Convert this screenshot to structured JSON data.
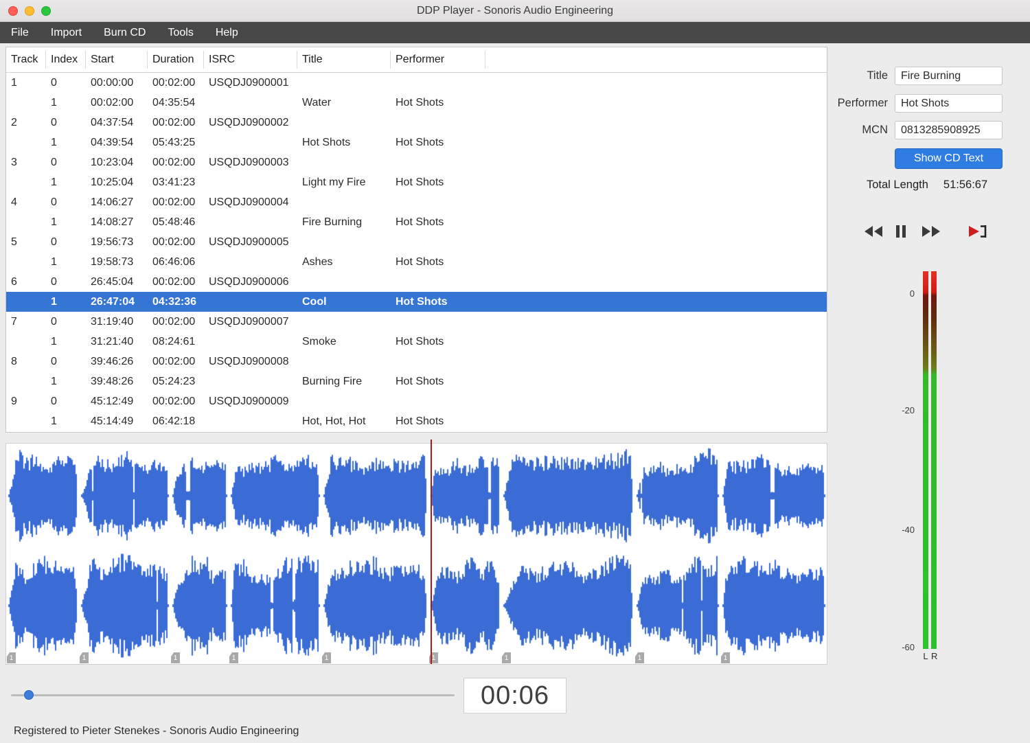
{
  "colors": {
    "selection": "#3575d3",
    "accent_button": "#2f7de2",
    "waveform": "#3b6cd6",
    "playhead": "#b01818"
  },
  "titlebar": {
    "title": "DDP Player - Sonoris Audio Engineering"
  },
  "menu": {
    "items": [
      "File",
      "Import",
      "Burn CD",
      "Tools",
      "Help"
    ]
  },
  "table": {
    "columns": [
      "Track",
      "Index",
      "Start",
      "Duration",
      "ISRC",
      "Title",
      "Performer"
    ],
    "rows": [
      {
        "track": "1",
        "index": "0",
        "start": "00:00:00",
        "duration": "00:02:00",
        "isrc": "USQDJ0900001",
        "title": "",
        "performer": ""
      },
      {
        "track": "",
        "index": "1",
        "start": "00:02:00",
        "duration": "04:35:54",
        "isrc": "",
        "title": "Water",
        "performer": "Hot Shots"
      },
      {
        "track": "2",
        "index": "0",
        "start": "04:37:54",
        "duration": "00:02:00",
        "isrc": "USQDJ0900002",
        "title": "",
        "performer": ""
      },
      {
        "track": "",
        "index": "1",
        "start": "04:39:54",
        "duration": "05:43:25",
        "isrc": "",
        "title": "Hot Shots",
        "performer": "Hot Shots"
      },
      {
        "track": "3",
        "index": "0",
        "start": "10:23:04",
        "duration": "00:02:00",
        "isrc": "USQDJ0900003",
        "title": "",
        "performer": ""
      },
      {
        "track": "",
        "index": "1",
        "start": "10:25:04",
        "duration": "03:41:23",
        "isrc": "",
        "title": "Light my Fire",
        "performer": "Hot Shots"
      },
      {
        "track": "4",
        "index": "0",
        "start": "14:06:27",
        "duration": "00:02:00",
        "isrc": "USQDJ0900004",
        "title": "",
        "performer": ""
      },
      {
        "track": "",
        "index": "1",
        "start": "14:08:27",
        "duration": "05:48:46",
        "isrc": "",
        "title": "Fire Burning",
        "performer": "Hot Shots"
      },
      {
        "track": "5",
        "index": "0",
        "start": "19:56:73",
        "duration": "00:02:00",
        "isrc": "USQDJ0900005",
        "title": "",
        "performer": ""
      },
      {
        "track": "",
        "index": "1",
        "start": "19:58:73",
        "duration": "06:46:06",
        "isrc": "",
        "title": "Ashes",
        "performer": "Hot Shots"
      },
      {
        "track": "6",
        "index": "0",
        "start": "26:45:04",
        "duration": "00:02:00",
        "isrc": "USQDJ0900006",
        "title": "",
        "performer": ""
      },
      {
        "track": "",
        "index": "1",
        "start": "26:47:04",
        "duration": "04:32:36",
        "isrc": "",
        "title": "Cool",
        "performer": "Hot Shots",
        "selected": true
      },
      {
        "track": "7",
        "index": "0",
        "start": "31:19:40",
        "duration": "00:02:00",
        "isrc": "USQDJ0900007",
        "title": "",
        "performer": ""
      },
      {
        "track": "",
        "index": "1",
        "start": "31:21:40",
        "duration": "08:24:61",
        "isrc": "",
        "title": "Smoke",
        "performer": "Hot Shots"
      },
      {
        "track": "8",
        "index": "0",
        "start": "39:46:26",
        "duration": "00:02:00",
        "isrc": "USQDJ0900008",
        "title": "",
        "performer": ""
      },
      {
        "track": "",
        "index": "1",
        "start": "39:48:26",
        "duration": "05:24:23",
        "isrc": "",
        "title": "Burning Fire",
        "performer": "Hot Shots"
      },
      {
        "track": "9",
        "index": "0",
        "start": "45:12:49",
        "duration": "00:02:00",
        "isrc": "USQDJ0900009",
        "title": "",
        "performer": ""
      },
      {
        "track": "",
        "index": "1",
        "start": "45:14:49",
        "duration": "06:42:18",
        "isrc": "",
        "title": "Hot, Hot, Hot",
        "performer": "Hot Shots"
      }
    ]
  },
  "details": {
    "title_label": "Title",
    "title_value": "Fire Burning",
    "performer_label": "Performer",
    "performer_value": "Hot Shots",
    "mcn_label": "MCN",
    "mcn_value": "0813285908925",
    "show_cd_text_label": "Show CD Text",
    "total_length_label": "Total Length",
    "total_length_value": "51:56:67"
  },
  "transport": {
    "icons": [
      "rewind-icon",
      "pause-icon",
      "fast-forward-icon",
      "play-to-marker-icon"
    ]
  },
  "meter": {
    "scale": [
      "0",
      "-20",
      "-40",
      "-60"
    ],
    "channels": [
      "L",
      "R"
    ]
  },
  "waveform": {
    "boundaries": [
      0,
      0.089,
      0.2,
      0.271,
      0.384,
      0.515,
      0.603,
      0.766,
      0.87,
      1.0
    ],
    "marker_label": "1",
    "playhead_fraction": 0.517
  },
  "playback": {
    "time": "00:06",
    "slider_fraction": 0.03
  },
  "statusbar": {
    "text": "Registered to Pieter Stenekes - Sonoris Audio Engineering"
  }
}
